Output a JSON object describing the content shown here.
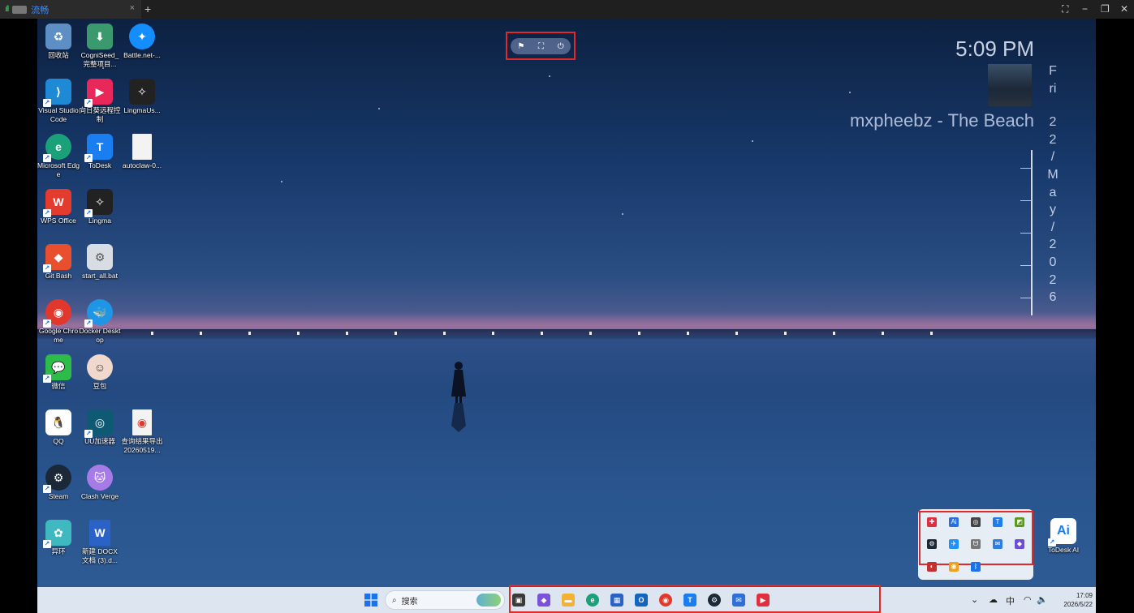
{
  "window": {
    "tab_label": "流畅",
    "signal": "ıll",
    "close_glyph": "×",
    "new_tab": "+",
    "controls": [
      "⛶",
      "−",
      "❐",
      "✕"
    ]
  },
  "desktop_icons": [
    {
      "label": "回收站",
      "color": "#5e8fc4",
      "glyph": "♻"
    },
    {
      "label": "CogniSeed_完整项目...",
      "color": "#3a9a6e",
      "glyph": "⬇"
    },
    {
      "label": "Battle.net-...",
      "color": "#148eff",
      "glyph": "✦"
    },
    {
      "label": "Visual Studio Code",
      "color": "#1e8ad6",
      "glyph": "⟩"
    },
    {
      "label": "向日葵远程控制",
      "color": "#e8285a",
      "glyph": "▶"
    },
    {
      "label": "LingmaUs...",
      "color": "#222222",
      "glyph": "✧"
    },
    {
      "label": "Microsoft Edge",
      "color": "#1aa17a",
      "glyph": "e"
    },
    {
      "label": "ToDesk",
      "color": "#1a7df0",
      "glyph": "T"
    },
    {
      "label": "autoclaw-0...",
      "color": "#f3f3f3",
      "glyph": ""
    },
    {
      "label": "WPS Office",
      "color": "#e43b2f",
      "glyph": "W"
    },
    {
      "label": "Lingma",
      "color": "#222222",
      "glyph": "✧"
    },
    {
      "label": "Git Bash",
      "color": "#e8502d",
      "glyph": "◆"
    },
    {
      "label": "start_all.bat",
      "color": "#d8dde3",
      "glyph": "⚙"
    },
    {
      "label": "Google Chrome",
      "color": "#e2372c",
      "glyph": "◉"
    },
    {
      "label": "Docker Desktop",
      "color": "#1f95e6",
      "glyph": "🐳"
    },
    {
      "label": "微信",
      "color": "#2dbb4a",
      "glyph": "💬"
    },
    {
      "label": "豆包",
      "color": "#f0d8cc",
      "glyph": "☺"
    },
    {
      "label": "QQ",
      "color": "#111111",
      "glyph": "🐧"
    },
    {
      "label": "UU加速器",
      "color": "#0e5a72",
      "glyph": "◎"
    },
    {
      "label": "查询结果导出20260519...",
      "color": "#f3f3f3",
      "glyph": "◉"
    },
    {
      "label": "Steam",
      "color": "#1b2838",
      "glyph": "⚙"
    },
    {
      "label": "Clash Verge",
      "color": "#a67be8",
      "glyph": "🐱"
    },
    {
      "label": "异环",
      "color": "#3fb8c0",
      "glyph": "✿"
    },
    {
      "label": "新建 DOCX 文档 (3).d...",
      "color": "#2b62c6",
      "glyph": "W"
    },
    {
      "label": "ToDesk AI",
      "color": "#ffffff",
      "glyph": "Ai"
    }
  ],
  "floating_toolbar": {
    "buttons": [
      "⚑",
      "⛶",
      "⏻"
    ]
  },
  "widget": {
    "time": "5:09 PM",
    "song": "mxpheebz - The Beach",
    "vertical_date": [
      "F",
      "ri",
      "2",
      "2",
      "/",
      "M",
      "a",
      "y",
      "/",
      "2",
      "0",
      "2",
      "6"
    ]
  },
  "tray_overflow": {
    "icons": [
      {
        "name": "sunlogin-tray-icon",
        "color": "#e03040",
        "glyph": "✚"
      },
      {
        "name": "todesk-ai-tray-icon",
        "color": "#2a6fdb",
        "glyph": "Ai"
      },
      {
        "name": "lingma-tray-icon",
        "color": "#444444",
        "glyph": "◎"
      },
      {
        "name": "todesk-tray-icon",
        "color": "#1a7df0",
        "glyph": "T"
      },
      {
        "name": "nvidia-tray-icon",
        "color": "#5a9a1a",
        "glyph": "◩"
      },
      {
        "name": "steam-tray-icon",
        "color": "#1b2838",
        "glyph": "⚙"
      },
      {
        "name": "feishu-tray-icon",
        "color": "#1e90ff",
        "glyph": "✈"
      },
      {
        "name": "cat-tray-icon",
        "color": "#777777",
        "glyph": "ᗢ"
      },
      {
        "name": "qq-tray-icon",
        "color": "#2f7de1",
        "glyph": "✉"
      },
      {
        "name": "copilot-tray-icon",
        "color": "#6a4fd6",
        "glyph": "◆"
      },
      {
        "name": "wechat-tray-icon",
        "color": "#c43030",
        "glyph": "◐"
      },
      {
        "name": "chrome-tray-icon",
        "color": "#f0a020",
        "glyph": "◉"
      },
      {
        "name": "bluetooth-tray-icon",
        "color": "#1a73e8",
        "glyph": "ᛒ"
      }
    ]
  },
  "taskbar": {
    "search_placeholder": "搜索",
    "pinned": [
      {
        "name": "task-view",
        "color": "#3a3a3a",
        "glyph": "▣"
      },
      {
        "name": "copilot",
        "color": "#7b52d9",
        "glyph": "◆"
      },
      {
        "name": "file-explorer",
        "color": "#f2b233",
        "glyph": "▬"
      },
      {
        "name": "edge",
        "color": "#1aa17a",
        "glyph": "e"
      },
      {
        "name": "store",
        "color": "#2b62c6",
        "glyph": "▦"
      },
      {
        "name": "outlook",
        "color": "#1565c0",
        "glyph": "O"
      },
      {
        "name": "chrome",
        "color": "#e2372c",
        "glyph": "◉"
      },
      {
        "name": "todesk",
        "color": "#1a7df0",
        "glyph": "T"
      },
      {
        "name": "steam",
        "color": "#1b2838",
        "glyph": "⚙"
      },
      {
        "name": "qq-mail",
        "color": "#2f6fd6",
        "glyph": "✉"
      },
      {
        "name": "sunlogin",
        "color": "#e03040",
        "glyph": "▶"
      }
    ],
    "tray": {
      "chevron": "⌄",
      "ime": "中",
      "time": "17:09",
      "date": "2026/5/22"
    }
  }
}
